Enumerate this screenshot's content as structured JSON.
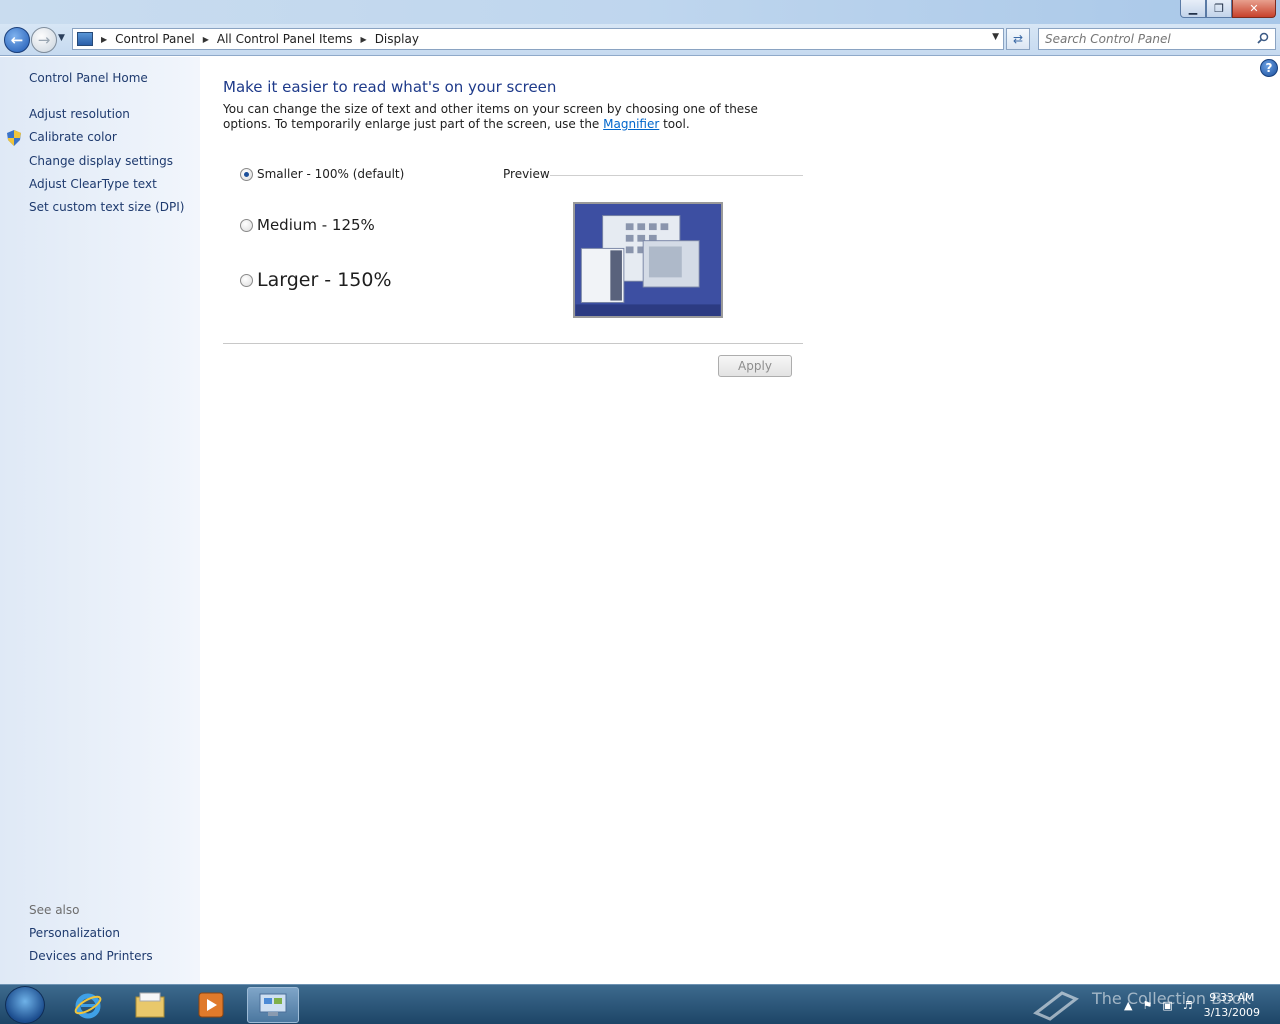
{
  "window": {
    "controls": {
      "minimize": "▁",
      "maximize": "❐",
      "close": "✕"
    }
  },
  "address_bar": {
    "breadcrumbs": [
      "Control Panel",
      "All Control Panel Items",
      "Display"
    ],
    "search_placeholder": "Search Control Panel"
  },
  "sidebar": {
    "home": "Control Panel Home",
    "tasks": [
      "Adjust resolution",
      "Calibrate color",
      "Change display settings",
      "Adjust ClearType text",
      "Set custom text size (DPI)"
    ],
    "see_also_label": "See also",
    "see_also": [
      "Personalization",
      "Devices and Printers"
    ]
  },
  "main": {
    "title": "Make it easier to read what's on your screen",
    "description_before": "You can change the size of text and other items on your screen by choosing one of these options. To temporarily enlarge just part of the screen, use the ",
    "description_link": "Magnifier",
    "description_after": " tool.",
    "options": [
      {
        "label": "Smaller - 100% (default)",
        "selected": true
      },
      {
        "label": "Medium - 125%",
        "selected": false
      },
      {
        "label": "Larger - 150%",
        "selected": false
      }
    ],
    "preview_label": "Preview",
    "apply_label": "Apply",
    "help_glyph": "?"
  },
  "taskbar": {
    "time": "9:33 AM",
    "date": "3/13/2009",
    "watermark": "The Collection Book"
  },
  "colors": {
    "title_blue": "#1e3a8a",
    "link_blue": "#1e3a6e",
    "taskbar": "#1d4567"
  }
}
